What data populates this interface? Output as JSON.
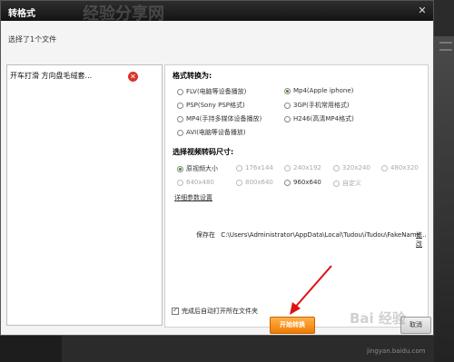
{
  "dialog": {
    "title": "转格式",
    "close_icon": "close-icon",
    "subtitle": "选择了1个文件"
  },
  "file_list": {
    "items": [
      {
        "name": "开车打滑 方向盘毛绒套...",
        "remove_icon": "remove-icon"
      }
    ]
  },
  "format": {
    "title": "格式转换为:",
    "options": [
      {
        "label": "FLV(电脑等设备播放)",
        "checked": false
      },
      {
        "label": "Mp4(Apple iphone)",
        "checked": true
      },
      {
        "label": "PSP(Sony PSP格式)",
        "checked": false
      },
      {
        "label": "3GP(手机常用格式)",
        "checked": false
      },
      {
        "label": "MP4(手持多媒体设备播放)",
        "checked": false
      },
      {
        "label": "H246(高清MP4格式)",
        "checked": false
      },
      {
        "label": "AVI(电脑等设备播放)",
        "checked": false
      }
    ]
  },
  "resolution": {
    "title": "选择视频转码尺寸:",
    "options": [
      {
        "label": "原视频大小",
        "checked": true,
        "disabled": false
      },
      {
        "label": "176x144",
        "checked": false,
        "disabled": true
      },
      {
        "label": "240x192",
        "checked": false,
        "disabled": true
      },
      {
        "label": "320x240",
        "checked": false,
        "disabled": true
      },
      {
        "label": "480x320",
        "checked": false,
        "disabled": true
      },
      {
        "label": "640x480",
        "checked": false,
        "disabled": true
      },
      {
        "label": "800x640",
        "checked": false,
        "disabled": true
      },
      {
        "label": "960x640",
        "checked": false,
        "disabled": false
      },
      {
        "label": "自定义",
        "checked": false,
        "disabled": true
      }
    ],
    "advanced_link": "详细参数设置"
  },
  "save": {
    "label": "保存在",
    "path": "C:\\Users\\Administrator\\AppData\\Local\\Tudou\\iTudou\\FakeName...",
    "change_link": "修改"
  },
  "options": {
    "open_folder_label": "完成后自动打开所在文件夹",
    "open_folder_checked": true
  },
  "buttons": {
    "start": "开始转换",
    "cancel": "取消"
  },
  "watermarks": {
    "top": "经验分享网",
    "bottom": "Bai 经验",
    "bottom_url": "jingyan.baidu.com"
  },
  "colors": {
    "accent_orange": "#f07b00",
    "title_bar": "#1a1a1a",
    "arrow_red": "#e01010",
    "remove_red": "#d9342b"
  }
}
